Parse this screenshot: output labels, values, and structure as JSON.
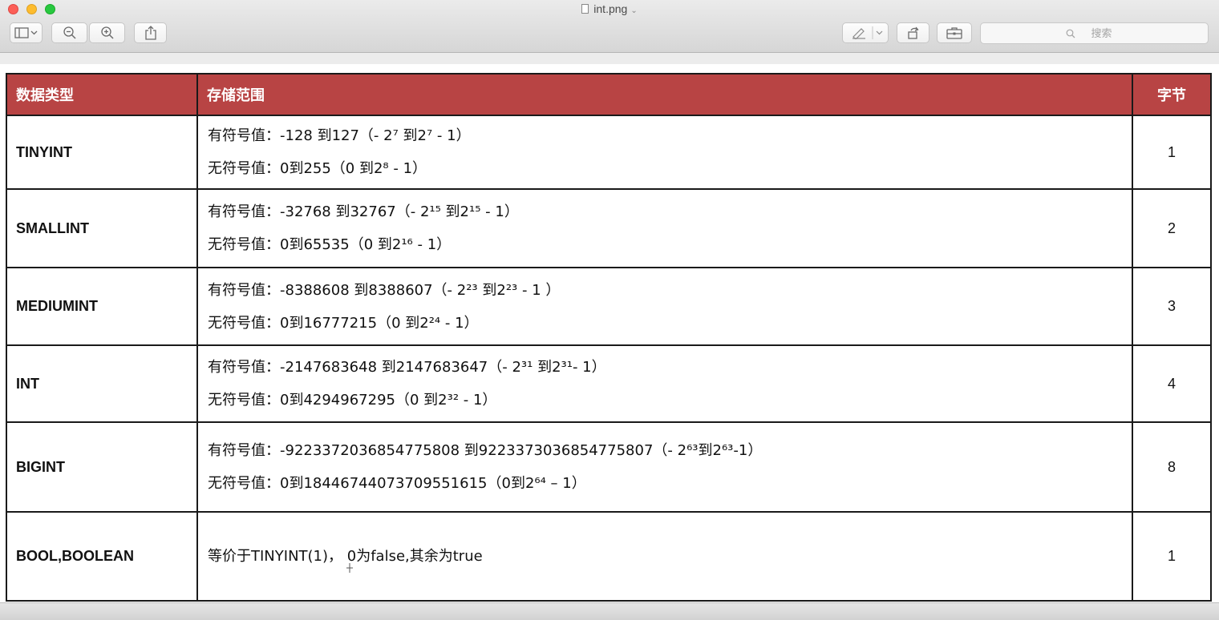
{
  "window": {
    "title": "int.png",
    "title_chevron": "⌄",
    "search_placeholder": "搜索"
  },
  "toolbar": {
    "icons": [
      "sidebar-icon",
      "zoom-out-icon",
      "zoom-in-icon",
      "share-icon",
      "markup-pen-icon",
      "chevron-down-icon",
      "rotate-icon",
      "toolbox-icon",
      "search-icon"
    ]
  },
  "colors": {
    "header_bg": "#b84444",
    "header_text": "#ffffff",
    "border": "#1a1a1a"
  },
  "table": {
    "headers": [
      "数据类型",
      "存储范围",
      "字节"
    ],
    "rows": [
      {
        "type": "TINYINT",
        "signed": "有符号值：-128 到127（- 2⁷ 到2⁷ - 1）",
        "unsigned": "无符号值：0到255（0 到2⁸ - 1）",
        "bytes": "1"
      },
      {
        "type": "SMALLINT",
        "signed": "有符号值：-32768 到32767（- 2¹⁵ 到2¹⁵ - 1）",
        "unsigned": "无符号值：0到65535（0 到2¹⁶ - 1）",
        "bytes": "2"
      },
      {
        "type": "MEDIUMINT",
        "signed": "有符号值：-8388608 到8388607（- 2²³ 到2²³ - 1 ）",
        "unsigned": "无符号值：0到16777215（0 到2²⁴ - 1）",
        "bytes": "3"
      },
      {
        "type": "INT",
        "signed": "有符号值：-2147683648 到2147683647（- 2³¹ 到2³¹- 1）",
        "unsigned": "无符号值：0到4294967295（0 到2³² - 1）",
        "bytes": "4"
      },
      {
        "type": "BIGINT",
        "signed": "有符号值：-9223372036854775808 到9223373036854775807（- 2⁶³到2⁶³-1）",
        "unsigned": "无符号值：0到18446744073709551615（0到2⁶⁴ – 1）",
        "bytes": "8"
      },
      {
        "type": "BOOL,BOOLEAN",
        "signed": "等价于TINYINT(1)， 0为false,其余为true",
        "unsigned": "",
        "bytes": "1"
      }
    ]
  }
}
